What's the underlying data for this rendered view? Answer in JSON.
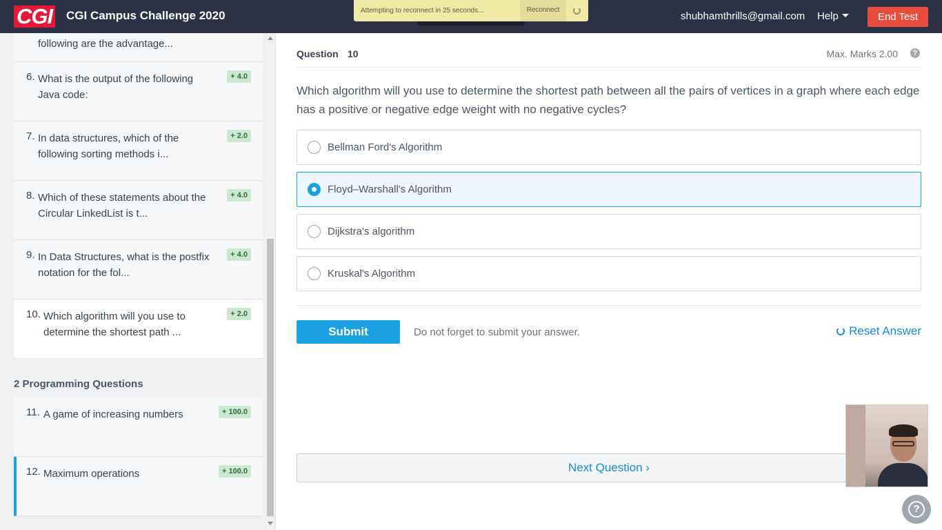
{
  "header": {
    "logo_text": "CGI",
    "title": "CGI Campus Challenge 2020",
    "reconnect_message": "Attempting to reconnect in 25 seconds...",
    "reconnect_label": "Reconnect",
    "user_email": "shubhamthrills@gmail.com",
    "help_label": "Help",
    "end_test_label": "End Test"
  },
  "sidebar": {
    "partial_item_text": "following are the advantage...",
    "mcq_items": [
      {
        "num": "6.",
        "text": "What is the output of the following Java code:",
        "marks": "+ 4.0"
      },
      {
        "num": "7.",
        "text": "In data structures, which of the following sorting methods i...",
        "marks": "+ 2.0"
      },
      {
        "num": "8.",
        "text": "Which of these statements about the Circular LinkedList is t...",
        "marks": "+ 4.0"
      },
      {
        "num": "9.",
        "text": "In Data Structures, what is the postfix notation for the fol...",
        "marks": "+ 4.0"
      },
      {
        "num": "10.",
        "text": "Which algorithm will you use to determine the shortest path ...",
        "marks": "+ 2.0"
      }
    ],
    "programming_section_title": "2 Programming Questions",
    "programming_items": [
      {
        "num": "11.",
        "text": "A game of increasing numbers",
        "marks": "+ 100.0"
      },
      {
        "num": "12.",
        "text": "Maximum operations",
        "marks": "+ 100.0"
      }
    ]
  },
  "question": {
    "label": "Question",
    "number": "10",
    "max_marks": "Max. Marks 2.00",
    "help_glyph": "?",
    "text": "Which algorithm will you use to determine the shortest path between all the pairs of vertices in a graph where each edge has a positive or negative edge weight with no negative cycles?",
    "options": [
      {
        "label": "Bellman Ford's Algorithm",
        "selected": false
      },
      {
        "label": "Floyd–Warshall's Algorithm",
        "selected": true
      },
      {
        "label": "Dijkstra's algorithm",
        "selected": false
      },
      {
        "label": "Kruskal's Algorithm",
        "selected": false
      }
    ],
    "submit_label": "Submit",
    "submit_note": "Do not forget to submit your answer.",
    "reset_label": "Reset Answer",
    "next_label": "Next Question ›"
  },
  "icons": {
    "reset": "reset-icon",
    "help_fab": "help-circle-icon",
    "caret": "caret-down-icon"
  },
  "colors": {
    "topbar": "#2b3245",
    "accent": "#1ba1e2",
    "end_test": "#e74c3c",
    "badge_bg": "#cce8d0"
  }
}
